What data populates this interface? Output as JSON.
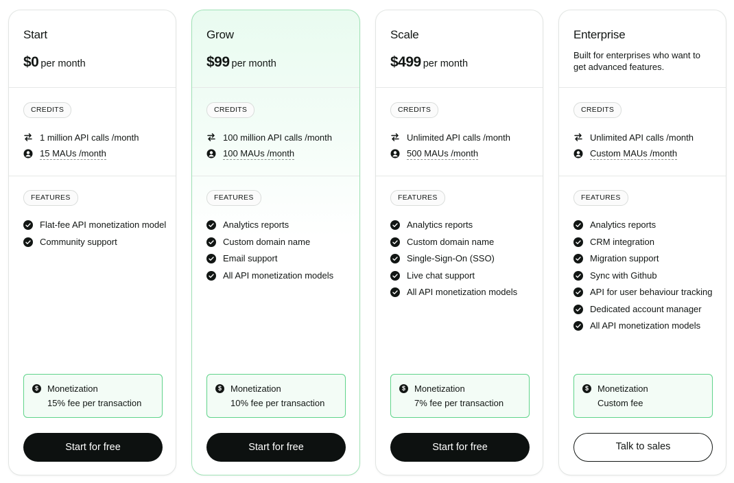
{
  "plans": [
    {
      "name": "Start",
      "price": "$0",
      "per": "per month",
      "credits_label": "CREDITS",
      "api_calls": "1 million API calls /month",
      "maus": "15 MAUs /month",
      "features_label": "FEATURES",
      "features": [
        "Flat-fee API monetization model",
        "Community support"
      ],
      "monetization_title": "Monetization",
      "monetization_fee": "15% fee per transaction",
      "cta": "Start for free"
    },
    {
      "name": "Grow",
      "price": "$99",
      "per": "per month",
      "credits_label": "CREDITS",
      "api_calls": "100 million API calls /month",
      "maus": "100 MAUs /month",
      "features_label": "FEATURES",
      "features": [
        "Analytics reports",
        "Custom domain name",
        "Email support",
        "All API monetization models"
      ],
      "monetization_title": "Monetization",
      "monetization_fee": "10% fee per transaction",
      "cta": "Start for free"
    },
    {
      "name": "Scale",
      "price": "$499",
      "per": "per month",
      "credits_label": "CREDITS",
      "api_calls": "Unlimited API calls /month",
      "maus": "500 MAUs /month",
      "features_label": "FEATURES",
      "features": [
        "Analytics reports",
        "Custom domain name",
        "Single-Sign-On (SSO)",
        "Live chat support",
        "All API monetization models"
      ],
      "monetization_title": "Monetization",
      "monetization_fee": "7% fee per transaction",
      "cta": "Start for free"
    },
    {
      "name": "Enterprise",
      "description": "Built for enterprises who want to get advanced features.",
      "credits_label": "CREDITS",
      "api_calls": "Unlimited API calls /month",
      "maus": "Custom MAUs /month",
      "features_label": "FEATURES",
      "features": [
        "Analytics reports",
        "CRM integration",
        "Migration support",
        "Sync with Github",
        "API for user behaviour tracking",
        "Dedicated account manager",
        "All API monetization models"
      ],
      "monetization_title": "Monetization",
      "monetization_fee": "Custom fee",
      "cta": "Talk to sales"
    }
  ],
  "icons": {
    "api_calls": "swap-arrows-icon",
    "maus": "user-circle-icon",
    "feature": "check-circle-icon",
    "monetization": "dollar-circle-icon"
  },
  "colors": {
    "accent_green": "#5fd38a",
    "highlight_bg": "#e9fbf0",
    "button_dark": "#0d1110"
  }
}
